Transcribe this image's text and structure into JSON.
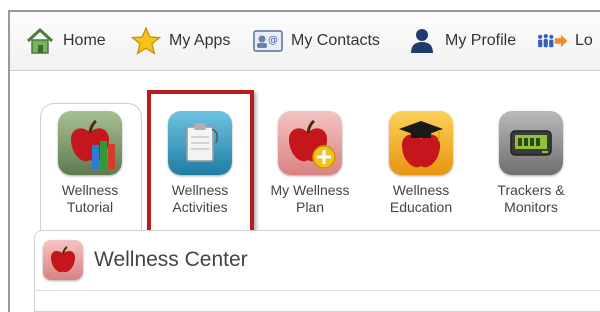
{
  "nav": {
    "home_label": "Home",
    "apps_label": "My Apps",
    "contacts_label": "My Contacts",
    "profile_label": "My Profile",
    "logout_label": "Lo"
  },
  "icons": {
    "home": "home-icon",
    "apps": "star-icon",
    "contacts": "contact-card-icon",
    "profile": "person-icon",
    "logout": "people-arrow-icon"
  },
  "apps": [
    {
      "line1": "Wellness",
      "line2": "Tutorial",
      "icon": "apple-books-icon"
    },
    {
      "line1": "Wellness",
      "line2": "Activities",
      "icon": "clipboard-icon"
    },
    {
      "line1": "My Wellness",
      "line2": "Plan",
      "icon": "apple-plus-icon"
    },
    {
      "line1": "Wellness",
      "line2": "Education",
      "icon": "apple-graduation-cap-icon"
    },
    {
      "line1": "Trackers &",
      "line2": "Monitors",
      "icon": "tracker-device-icon"
    }
  ],
  "panel": {
    "title": "Wellness Center",
    "icon": "apple-icon"
  },
  "colors": {
    "highlight": "#b71d1d",
    "tutorial_tile": "#7f9a6f",
    "activities_tile": "#2f8fb0",
    "plan_tile": "#e59a9a",
    "education_tile": "#f0a623",
    "trackers_tile": "#8a8a8a"
  }
}
